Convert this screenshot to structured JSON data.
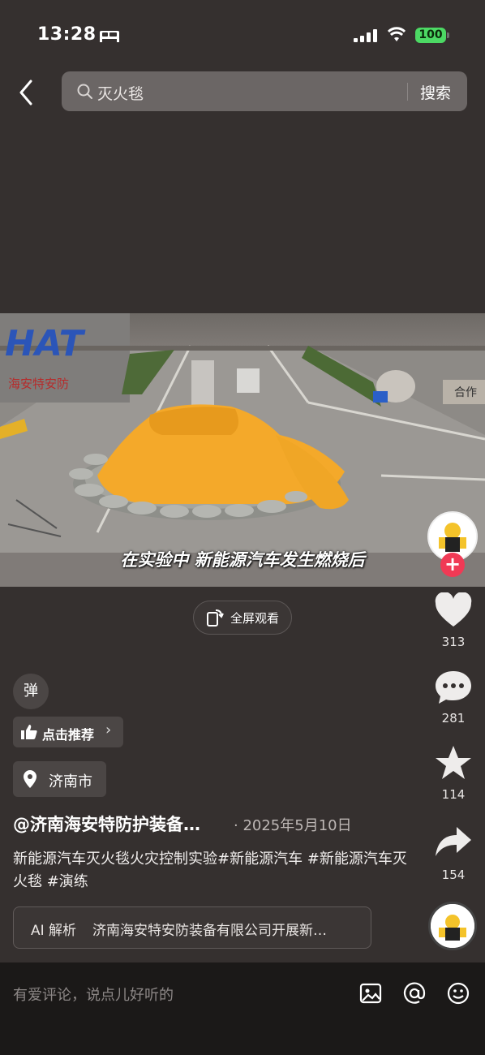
{
  "status_bar": {
    "time": "13:28",
    "battery": "100"
  },
  "search": {
    "query": "灭火毯",
    "button_label": "搜索"
  },
  "video": {
    "subtitle": "在实验中 新能源汽车发生燃烧后",
    "sign_text_left": "HAT",
    "sign_text_cn": "海安特安防",
    "sign_text_right": "合作"
  },
  "fullscreen": {
    "label": "全屏观看"
  },
  "actions": {
    "likes": "313",
    "comments": "281",
    "favorites": "114",
    "shares": "154"
  },
  "info": {
    "danmu_label": "弹",
    "recommend_label": "点击推荐",
    "location": "济南市",
    "author": "@济南海安特防护装备…",
    "date": "· 2025年5月10日",
    "description": "新能源汽车灭火毯火灾控制实验#新能源汽车 #新能源汽车灭火毯 #演练",
    "ai_label": "AI 解析",
    "ai_summary": "济南海安特安防装备有限公司开展新…"
  },
  "comment_bar": {
    "placeholder": "有爱评论，说点儿好听的"
  },
  "colors": {
    "background": "#35302f",
    "accent_red": "#f03a55",
    "battery_green": "#4cd964",
    "blanket_yellow": "#f4a92a"
  }
}
